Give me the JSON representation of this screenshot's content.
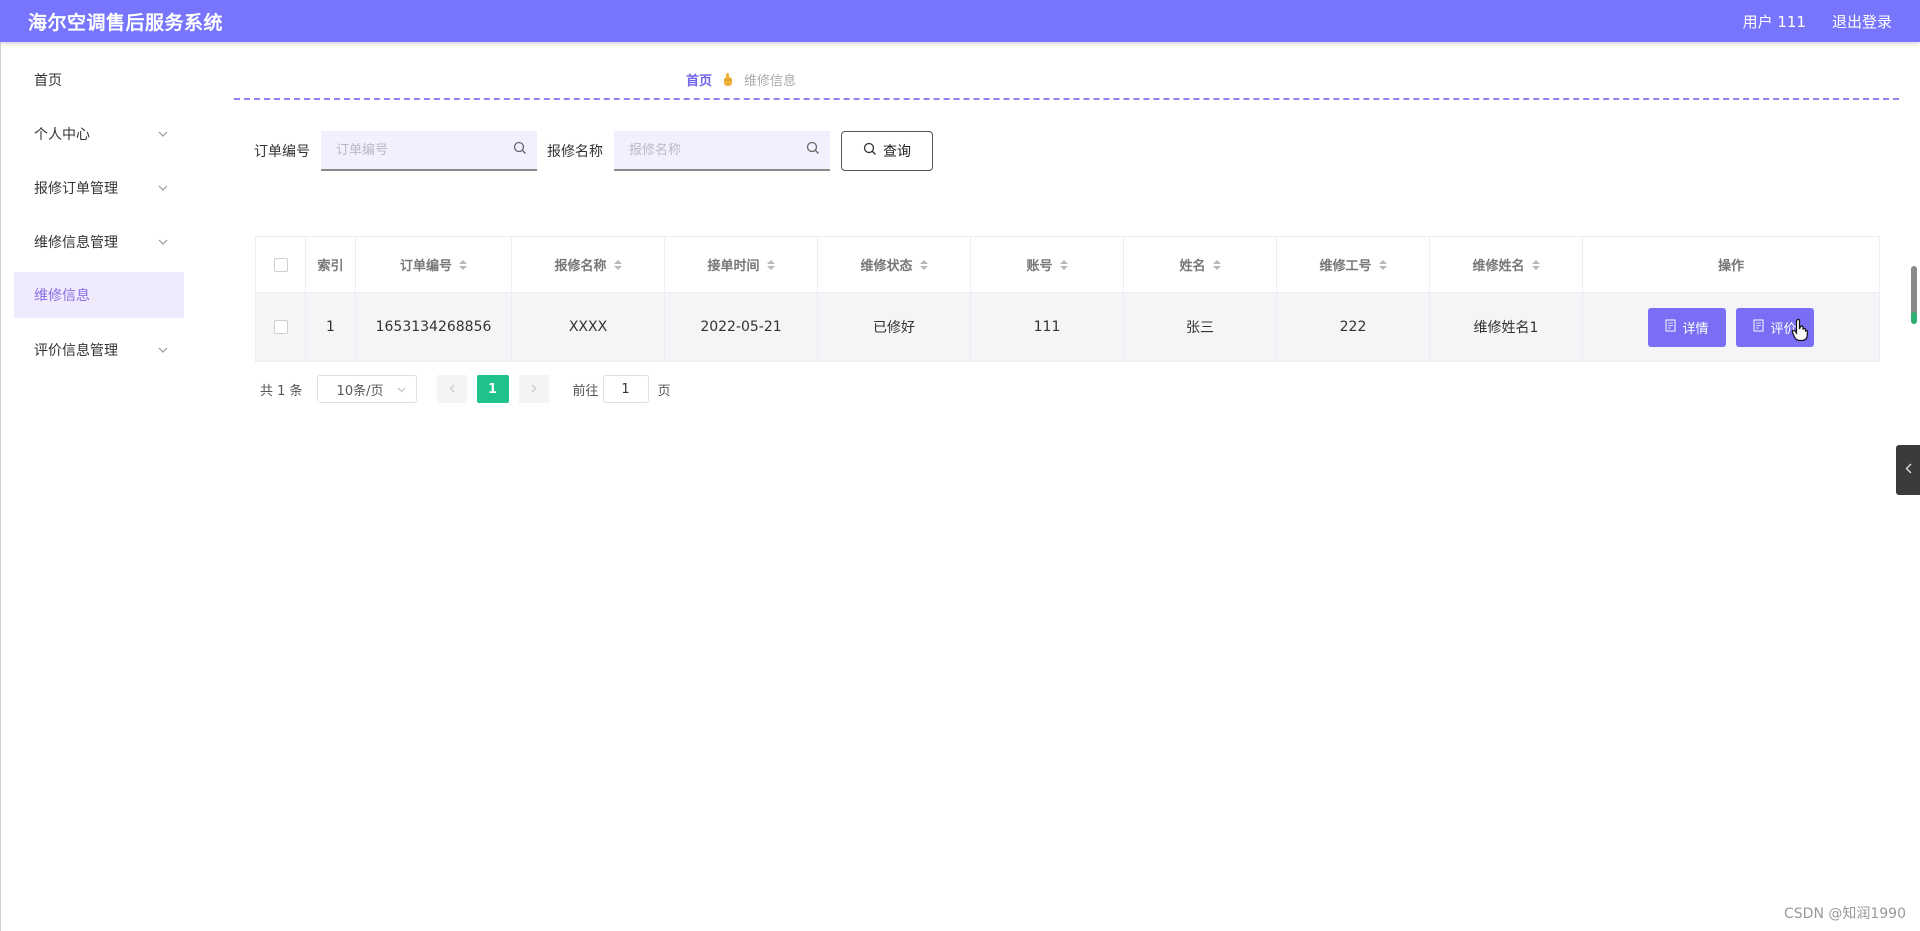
{
  "header": {
    "title": "海尔空调售后服务系统",
    "user": "用户 111",
    "logout": "退出登录",
    "accent_color": "#7775fb"
  },
  "sidebar": {
    "items": [
      {
        "label": "首页",
        "icon": "none"
      },
      {
        "label": "个人中心",
        "icon": "chevron-down-icon"
      },
      {
        "label": "报修订单管理",
        "icon": "chevron-down-icon"
      },
      {
        "label": "维修信息管理",
        "icon": "chevron-down-icon"
      },
      {
        "label": "维修信息",
        "active": true
      },
      {
        "label": "评价信息管理",
        "icon": "chevron-down-icon"
      }
    ]
  },
  "breadcrumb": {
    "home": "首页",
    "separator_icon": "hand-icon",
    "current": "维修信息"
  },
  "search": {
    "order_label": "订单编号",
    "order_placeholder": "订单编号",
    "order_value": "",
    "repair_label": "报修名称",
    "repair_placeholder": "报修名称",
    "repair_value": "",
    "button_label": "查询"
  },
  "table": {
    "columns": [
      "索引",
      "订单编号",
      "报修名称",
      "接单时间",
      "维修状态",
      "账号",
      "姓名",
      "维修工号",
      "维修姓名",
      "操作"
    ],
    "rows": [
      {
        "index": "1",
        "order_no": "1653134268856",
        "repair_name": "XXXX",
        "accept_time": "2022-05-21",
        "status": "已修好",
        "account": "111",
        "name": "张三",
        "worker_no": "222",
        "worker_name": "维修姓名1",
        "actions": [
          "详情",
          "评价"
        ]
      }
    ]
  },
  "pagination": {
    "total": "共 1 条",
    "page_size": "10条/页",
    "current_page": "1",
    "goto_label": "前往",
    "goto_value": "1",
    "page_suffix": "页"
  },
  "watermark": "CSDN @知润1990"
}
